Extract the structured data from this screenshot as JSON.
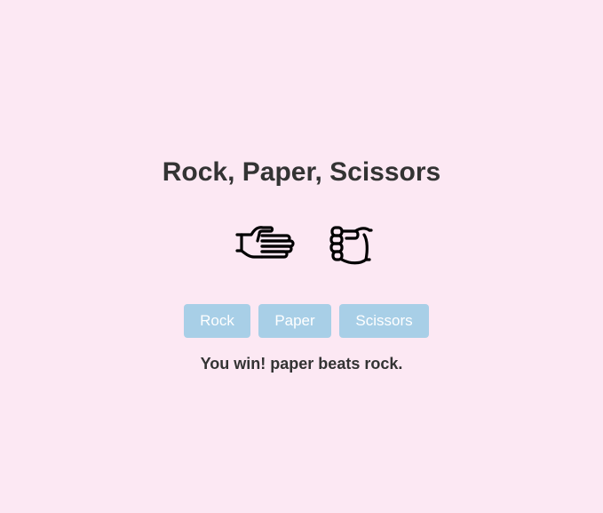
{
  "game": {
    "title": "Rock, Paper, Scissors",
    "player_hand_icon": "paper-hand-icon",
    "computer_hand_icon": "rock-fist-icon",
    "buttons": {
      "rock": "Rock",
      "paper": "Paper",
      "scissors": "Scissors"
    },
    "result": "You win! paper beats rock."
  },
  "colors": {
    "background": "#fce8f3",
    "button": "#a8cfe7",
    "button_text": "#ffffff",
    "text": "#333333"
  }
}
